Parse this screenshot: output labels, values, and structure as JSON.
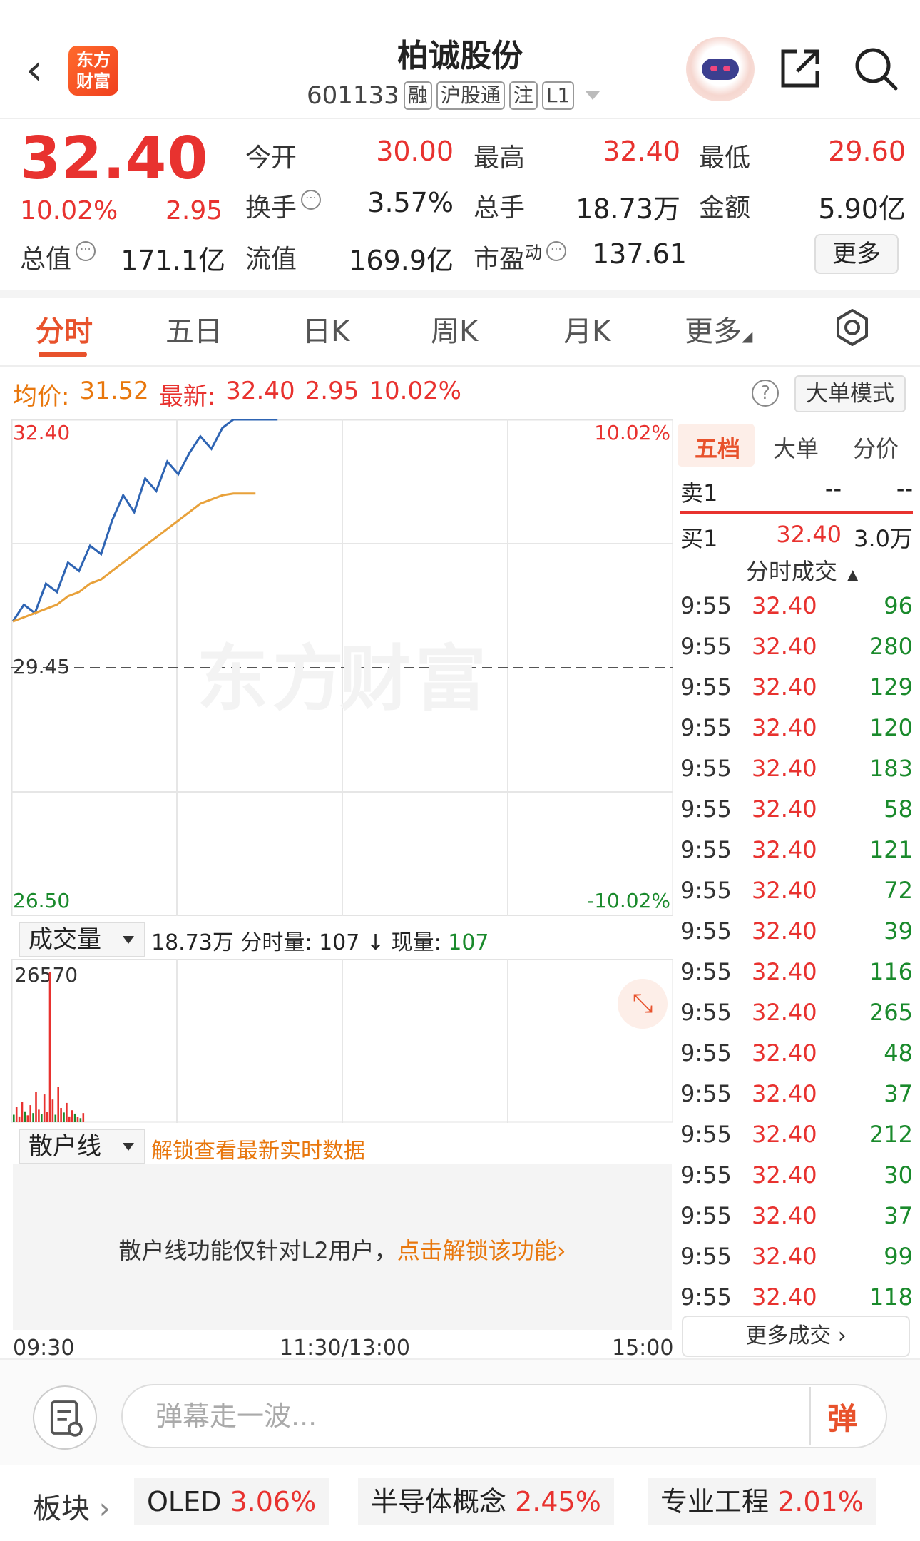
{
  "header": {
    "back_glyph": "‹",
    "logo_line1": "东方",
    "logo_line2": "财富",
    "title": "柏诚股份",
    "code": "601133",
    "tags": [
      "融",
      "沪股通",
      "注",
      "L1"
    ]
  },
  "quote": {
    "price": "32.40",
    "pct": "10.02%",
    "change": "2.95",
    "stats": [
      {
        "label": "今开",
        "value": "30.00",
        "color": "red"
      },
      {
        "label": "最高",
        "value": "32.40",
        "color": "red"
      },
      {
        "label": "最低",
        "value": "29.60",
        "color": "red"
      },
      {
        "label": "换手",
        "value": "3.57%",
        "color": "black"
      },
      {
        "label": "总手",
        "value": "18.73万",
        "color": "black"
      },
      {
        "label": "金额",
        "value": "5.90亿",
        "color": "black"
      },
      {
        "label": "总值",
        "value": "171.1亿",
        "color": "black"
      },
      {
        "label": "流值",
        "value": "169.9亿",
        "color": "black"
      },
      {
        "label": "市盈",
        "value": "137.61",
        "color": "black"
      }
    ],
    "pe_superscript": "动",
    "more_label": "更多"
  },
  "tabs": [
    "分时",
    "五日",
    "日K",
    "周K",
    "月K",
    "更多"
  ],
  "infoline": {
    "avg_label": "均价:",
    "avg_value": "31.52",
    "latest_label": "最新:",
    "latest_value": "32.40",
    "latest_change": "2.95",
    "latest_pct": "10.02%",
    "help_glyph": "?",
    "big_order_mode": "大单模式"
  },
  "chart_data": {
    "type": "line",
    "price_axis": {
      "top": "32.40",
      "mid": "29.45",
      "bottom": "26.50",
      "top_pct": "10.02%",
      "bottom_pct": "-10.02%"
    },
    "ylim": [
      26.5,
      32.4
    ],
    "series": [
      {
        "values": [
          30.0,
          30.2,
          30.1,
          30.45,
          30.35,
          30.7,
          30.6,
          30.9,
          30.8,
          31.2,
          31.5,
          31.3,
          31.7,
          31.55,
          31.9,
          31.75,
          32.0,
          32.2,
          32.05,
          32.3,
          32.4,
          32.4,
          32.4,
          32.4,
          32.4
        ],
        "color": "#2e64b3"
      },
      {
        "values": [
          30.0,
          30.05,
          30.1,
          30.15,
          30.2,
          30.3,
          30.35,
          30.45,
          30.5,
          30.6,
          30.7,
          30.8,
          30.9,
          31.0,
          31.1,
          31.2,
          31.3,
          31.4,
          31.45,
          31.5,
          31.52,
          31.52,
          31.52
        ],
        "color": "#e8a13a"
      }
    ],
    "volume_max_label": "26570",
    "volume": [
      1200,
      2600,
      900,
      3500,
      1800,
      1100,
      2900,
      1500,
      5200,
      2100,
      1300,
      4800,
      1700,
      26570,
      3900,
      1200,
      6100,
      2400,
      1600,
      3300,
      900,
      2000,
      1400,
      800,
      600,
      1500
    ],
    "volume_colors": [
      "g",
      "r",
      "r",
      "r",
      "g",
      "r",
      "r",
      "g",
      "r",
      "r",
      "g",
      "r",
      "r",
      "r",
      "r",
      "g",
      "r",
      "r",
      "g",
      "r",
      "r",
      "r",
      "g",
      "r",
      "g",
      "r"
    ],
    "time_labels": [
      "09:30",
      "11:30/13:00",
      "15:00"
    ]
  },
  "volume_panel": {
    "select_label": "成交量",
    "total": "18.73万",
    "fenshi_label": "分时量:",
    "fenshi_value": "107",
    "arrow": "↓",
    "current_label": "现量:",
    "current_value": "107"
  },
  "retail_panel": {
    "select_label": "散户线",
    "unlock_link": "解锁查看最新实时数据",
    "message": "散户线功能仅针对L2用户，",
    "message_link": "点击解锁该功能›"
  },
  "right_panel": {
    "tabs": [
      "五档",
      "大单",
      "分价"
    ],
    "ask": {
      "label": "卖1",
      "price": "--",
      "volume": "--"
    },
    "bid": {
      "label": "买1",
      "price": "32.40",
      "volume": "3.0万"
    },
    "trades_title": "分时成交",
    "trades": [
      {
        "t": "9:55",
        "p": "32.40",
        "v": "96"
      },
      {
        "t": "9:55",
        "p": "32.40",
        "v": "280"
      },
      {
        "t": "9:55",
        "p": "32.40",
        "v": "129"
      },
      {
        "t": "9:55",
        "p": "32.40",
        "v": "120"
      },
      {
        "t": "9:55",
        "p": "32.40",
        "v": "183"
      },
      {
        "t": "9:55",
        "p": "32.40",
        "v": "58"
      },
      {
        "t": "9:55",
        "p": "32.40",
        "v": "121"
      },
      {
        "t": "9:55",
        "p": "32.40",
        "v": "72"
      },
      {
        "t": "9:55",
        "p": "32.40",
        "v": "39"
      },
      {
        "t": "9:55",
        "p": "32.40",
        "v": "116"
      },
      {
        "t": "9:55",
        "p": "32.40",
        "v": "265"
      },
      {
        "t": "9:55",
        "p": "32.40",
        "v": "48"
      },
      {
        "t": "9:55",
        "p": "32.40",
        "v": "37"
      },
      {
        "t": "9:55",
        "p": "32.40",
        "v": "212"
      },
      {
        "t": "9:55",
        "p": "32.40",
        "v": "30"
      },
      {
        "t": "9:55",
        "p": "32.40",
        "v": "37"
      },
      {
        "t": "9:55",
        "p": "32.40",
        "v": "99"
      },
      {
        "t": "9:55",
        "p": "32.40",
        "v": "118"
      }
    ],
    "more_trades": "更多成交 ›"
  },
  "bottom": {
    "input_placeholder": "弹幕走一波...",
    "danmaku_glyph": "弹",
    "sector_label": "板块",
    "sectors": [
      {
        "name": "OLED",
        "pct": "3.06%"
      },
      {
        "name": "半导体概念",
        "pct": "2.45%"
      },
      {
        "name": "专业工程",
        "pct": "2.01%"
      }
    ]
  },
  "colors": {
    "up": "#e8322f",
    "down": "#1a8a2c",
    "accent": "#e8522c"
  }
}
